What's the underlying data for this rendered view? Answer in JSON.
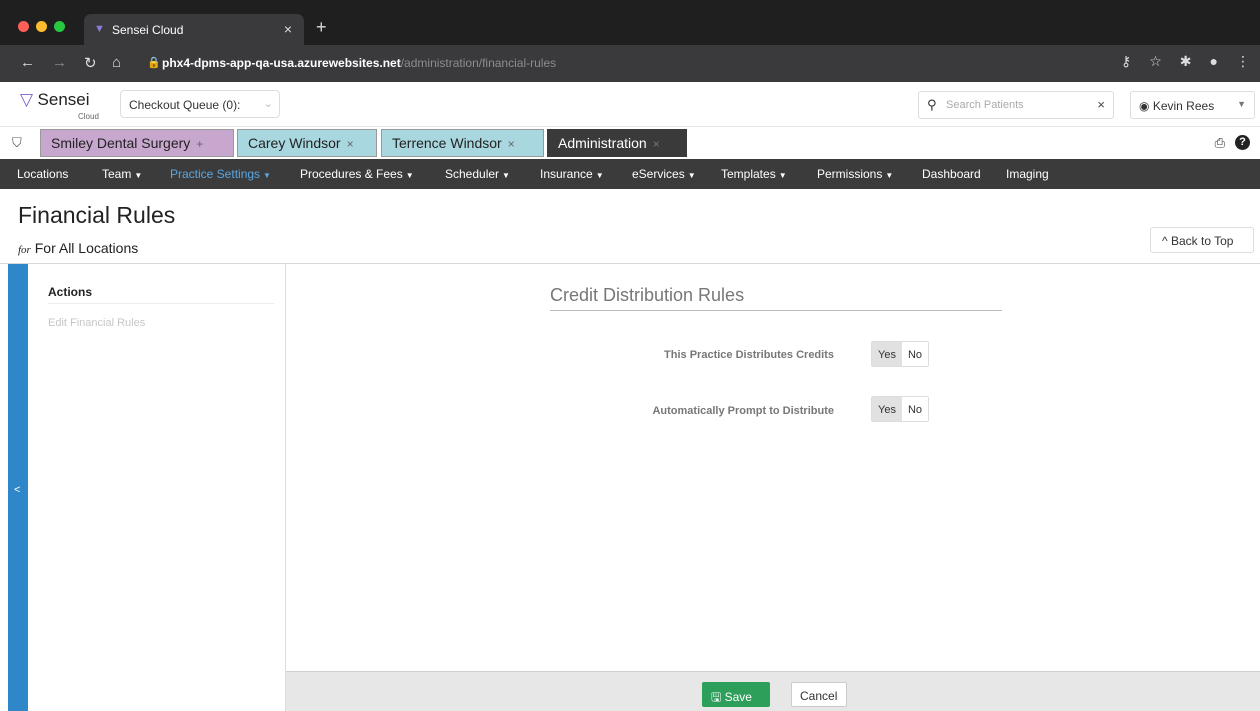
{
  "browser": {
    "tab_title": "Sensei Cloud",
    "url_host": "phx4-dpms-app-qa-usa.azurewebsites.net",
    "url_path": "/administration/financial-rules"
  },
  "app": {
    "logo_name": "Sensei",
    "logo_sub": "Cloud",
    "checkout_queue": "Checkout Queue (0):",
    "search_placeholder": "Search Patients",
    "user_name": "Kevin Rees"
  },
  "open_tabs": [
    "Smiley Dental Surgery",
    "Carey Windsor",
    "Terrence Windsor",
    "Administration"
  ],
  "menu": {
    "locations": "Locations",
    "team": "Team",
    "practice_settings": "Practice Settings",
    "procedures": "Procedures & Fees",
    "scheduler": "Scheduler",
    "insurance": "Insurance",
    "eservices": "eServices",
    "templates": "Templates",
    "permissions": "Permissions",
    "dashboard": "Dashboard",
    "imaging": "Imaging"
  },
  "page": {
    "title": "Financial Rules",
    "for_word": "for",
    "subtitle": "For All Locations",
    "back_to_top": "Back to Top"
  },
  "sidebar": {
    "heading": "Actions",
    "item": "Edit Financial Rules"
  },
  "section": {
    "title": "Credit Distribution Rules",
    "fields": [
      {
        "label": "This Practice Distributes Credits",
        "yes": "Yes",
        "no": "No",
        "selected": "Yes"
      },
      {
        "label": "Automatically Prompt to Distribute",
        "yes": "Yes",
        "no": "No",
        "selected": "Yes"
      }
    ]
  },
  "footer": {
    "save": "Save",
    "cancel": "Cancel"
  },
  "colors": {
    "menu_active": "#5aa7e2",
    "save_green": "#2e9e5b",
    "sidebar_blue": "#2f86c8"
  }
}
